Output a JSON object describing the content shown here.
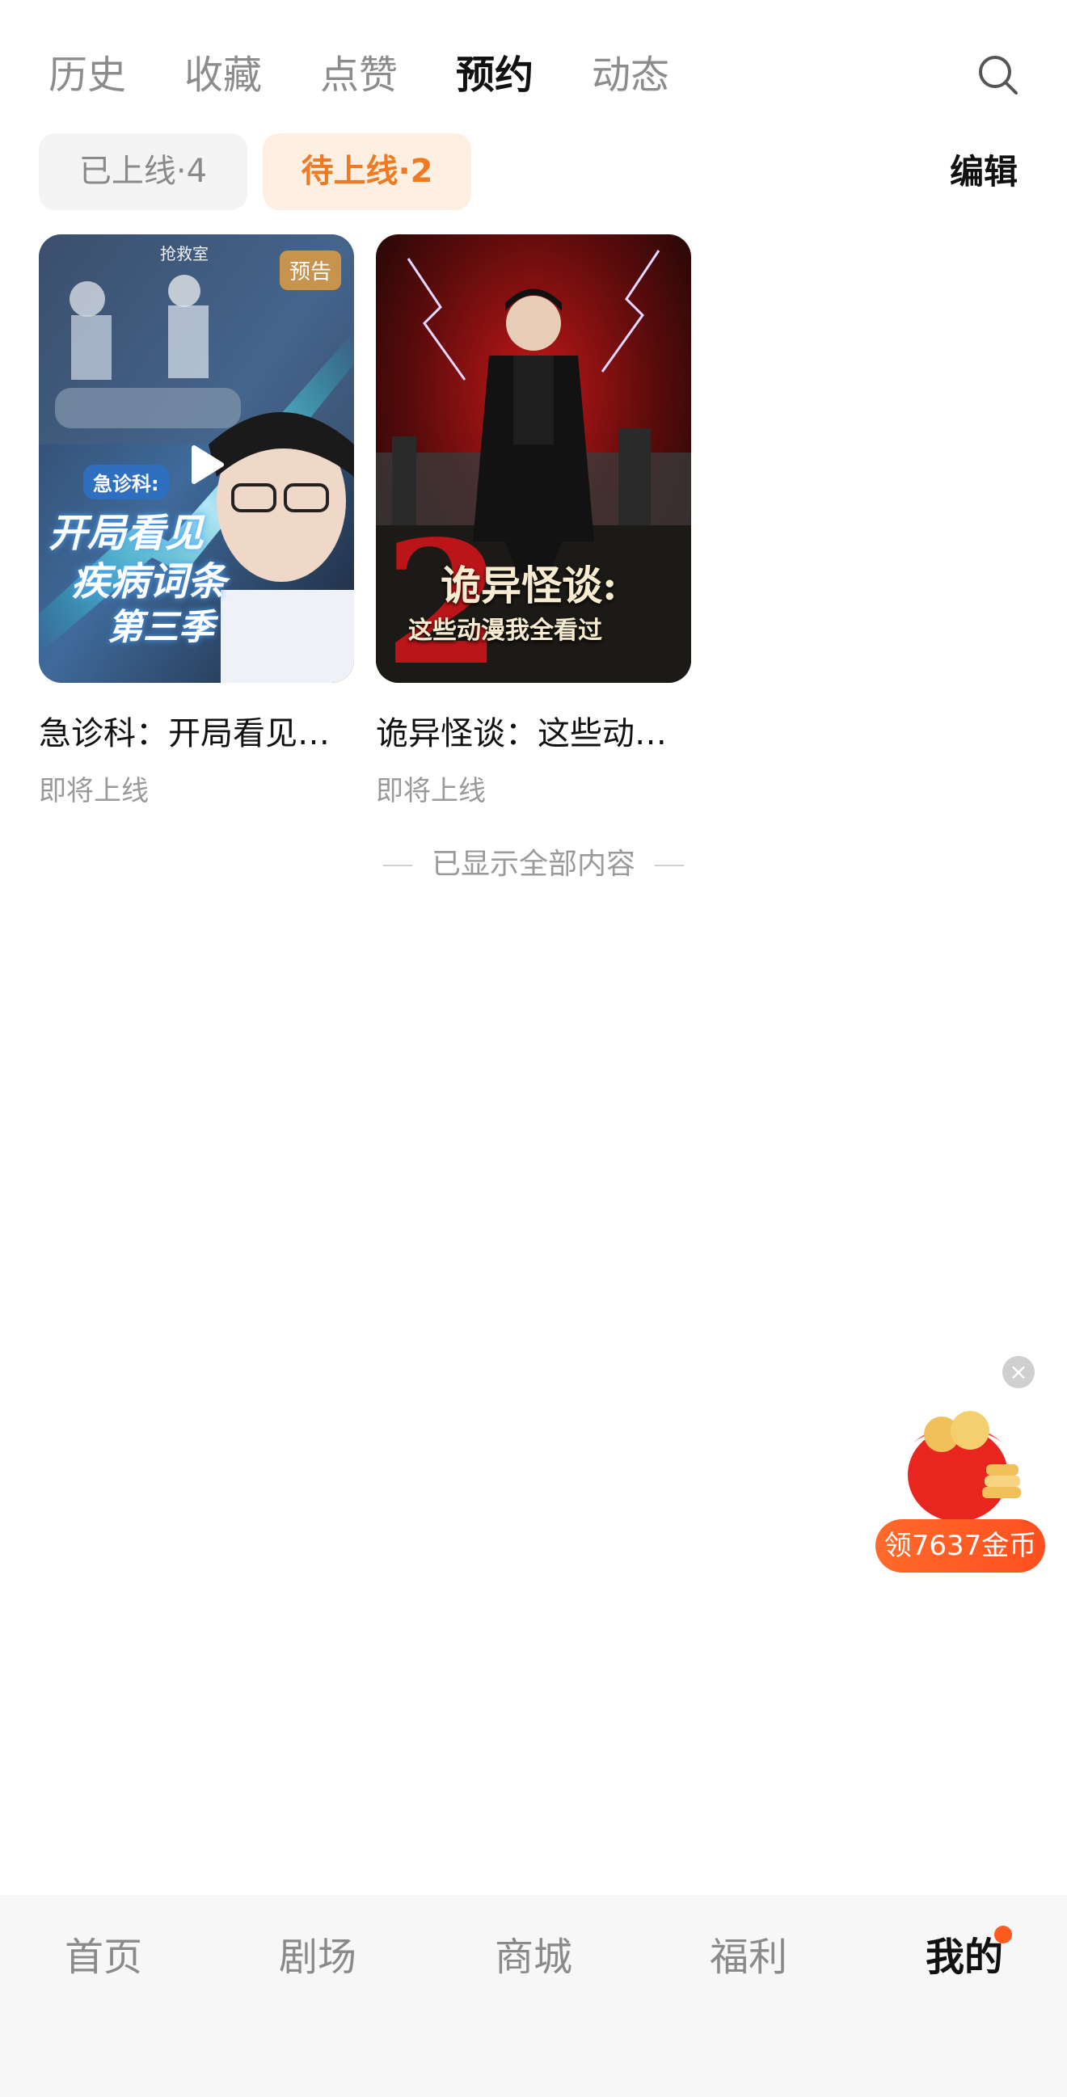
{
  "top_tabs": [
    {
      "label": "历史"
    },
    {
      "label": "收藏"
    },
    {
      "label": "点赞"
    },
    {
      "label": "预约"
    },
    {
      "label": "动态"
    }
  ],
  "active_tab": "预约",
  "filters": {
    "online": "已上线·4",
    "upcoming": "待上线·2"
  },
  "edit_label": "编辑",
  "cards": [
    {
      "title": "急诊科：开局看见疾病词条第三季",
      "status": "即将上线",
      "badge": "预告",
      "poster_top_text": "抢救室",
      "poster_text_1": "急诊科:",
      "poster_text_2": "开局看见",
      "poster_text_3": "疾病词条",
      "poster_text_4": "第三季"
    },
    {
      "title": "诡异怪谈：这些动漫我全看过",
      "status": "即将上线",
      "poster_text_1": "诡异怪谈:",
      "poster_text_2": "这些动漫我全看过",
      "poster_number": "2"
    }
  ],
  "end_notice": "已显示全部内容",
  "coin_pill": "领7637金币",
  "bottom_nav": [
    {
      "label": "首页"
    },
    {
      "label": "剧场"
    },
    {
      "label": "商城"
    },
    {
      "label": "福利"
    },
    {
      "label": "我的"
    }
  ],
  "colors": {
    "accent": "#f07a22",
    "badge": "#c7934d",
    "notification_dot": "#ff5a1f"
  }
}
